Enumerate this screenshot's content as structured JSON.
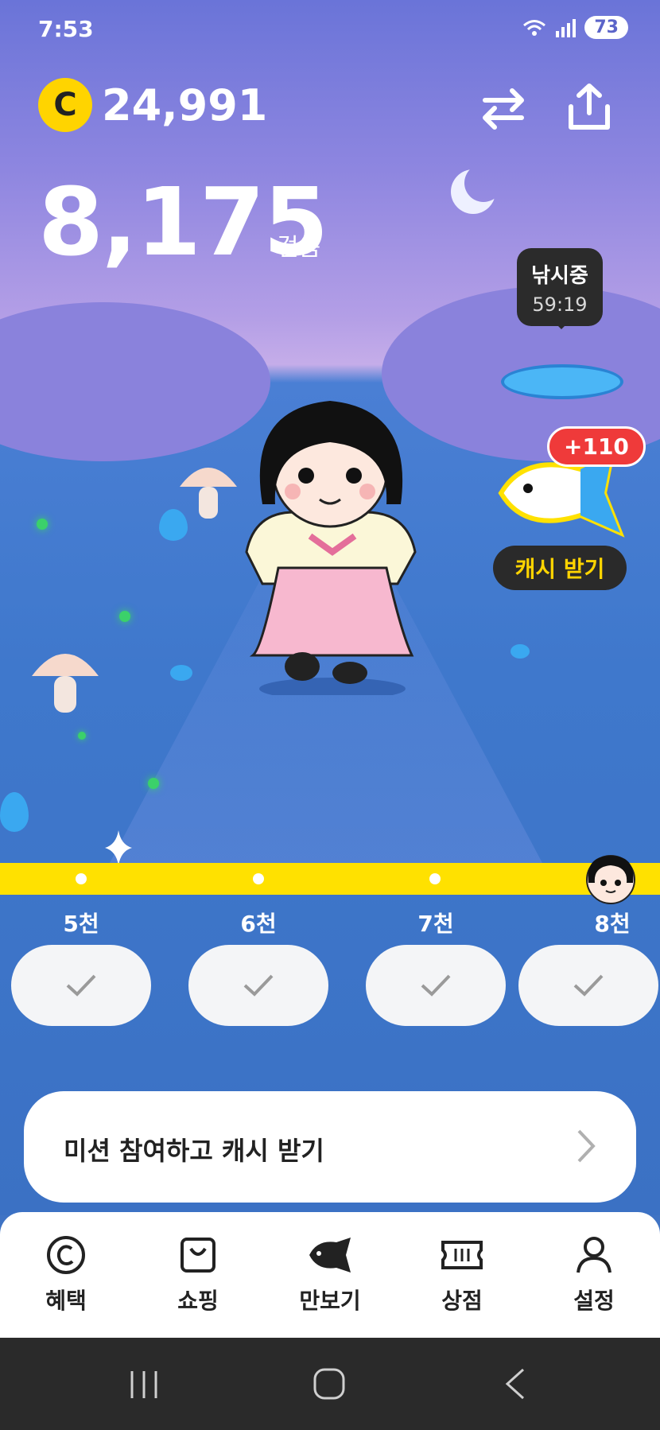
{
  "status": {
    "time": "7:53",
    "battery": "73"
  },
  "header": {
    "coin_symbol": "C",
    "coin_balance": "24,991"
  },
  "steps": {
    "value": "8,175",
    "unit": "걸음"
  },
  "fishing": {
    "status": "낚시중",
    "timer": "59:19"
  },
  "reward": {
    "badge": "+110",
    "collect_label": "캐시 받기"
  },
  "progress": {
    "filled_fraction": 0.95
  },
  "milestones": [
    {
      "label": "5천",
      "done": true
    },
    {
      "label": "6천",
      "done": true
    },
    {
      "label": "7천",
      "done": true
    },
    {
      "label": "8천",
      "done": true
    }
  ],
  "mission": {
    "label": "미션 참여하고 캐시 받기"
  },
  "nav": [
    {
      "label": "혜택",
      "icon": "copyright-icon",
      "active": false
    },
    {
      "label": "쇼핑",
      "icon": "shopping-bag-icon",
      "active": false
    },
    {
      "label": "만보기",
      "icon": "fish-icon",
      "active": true
    },
    {
      "label": "상점",
      "icon": "ticket-icon",
      "active": false
    },
    {
      "label": "설정",
      "icon": "person-icon",
      "active": false
    }
  ],
  "colors": {
    "accent": "#ffe100",
    "badge": "#ef3a3a",
    "coin": "#ffd400"
  }
}
